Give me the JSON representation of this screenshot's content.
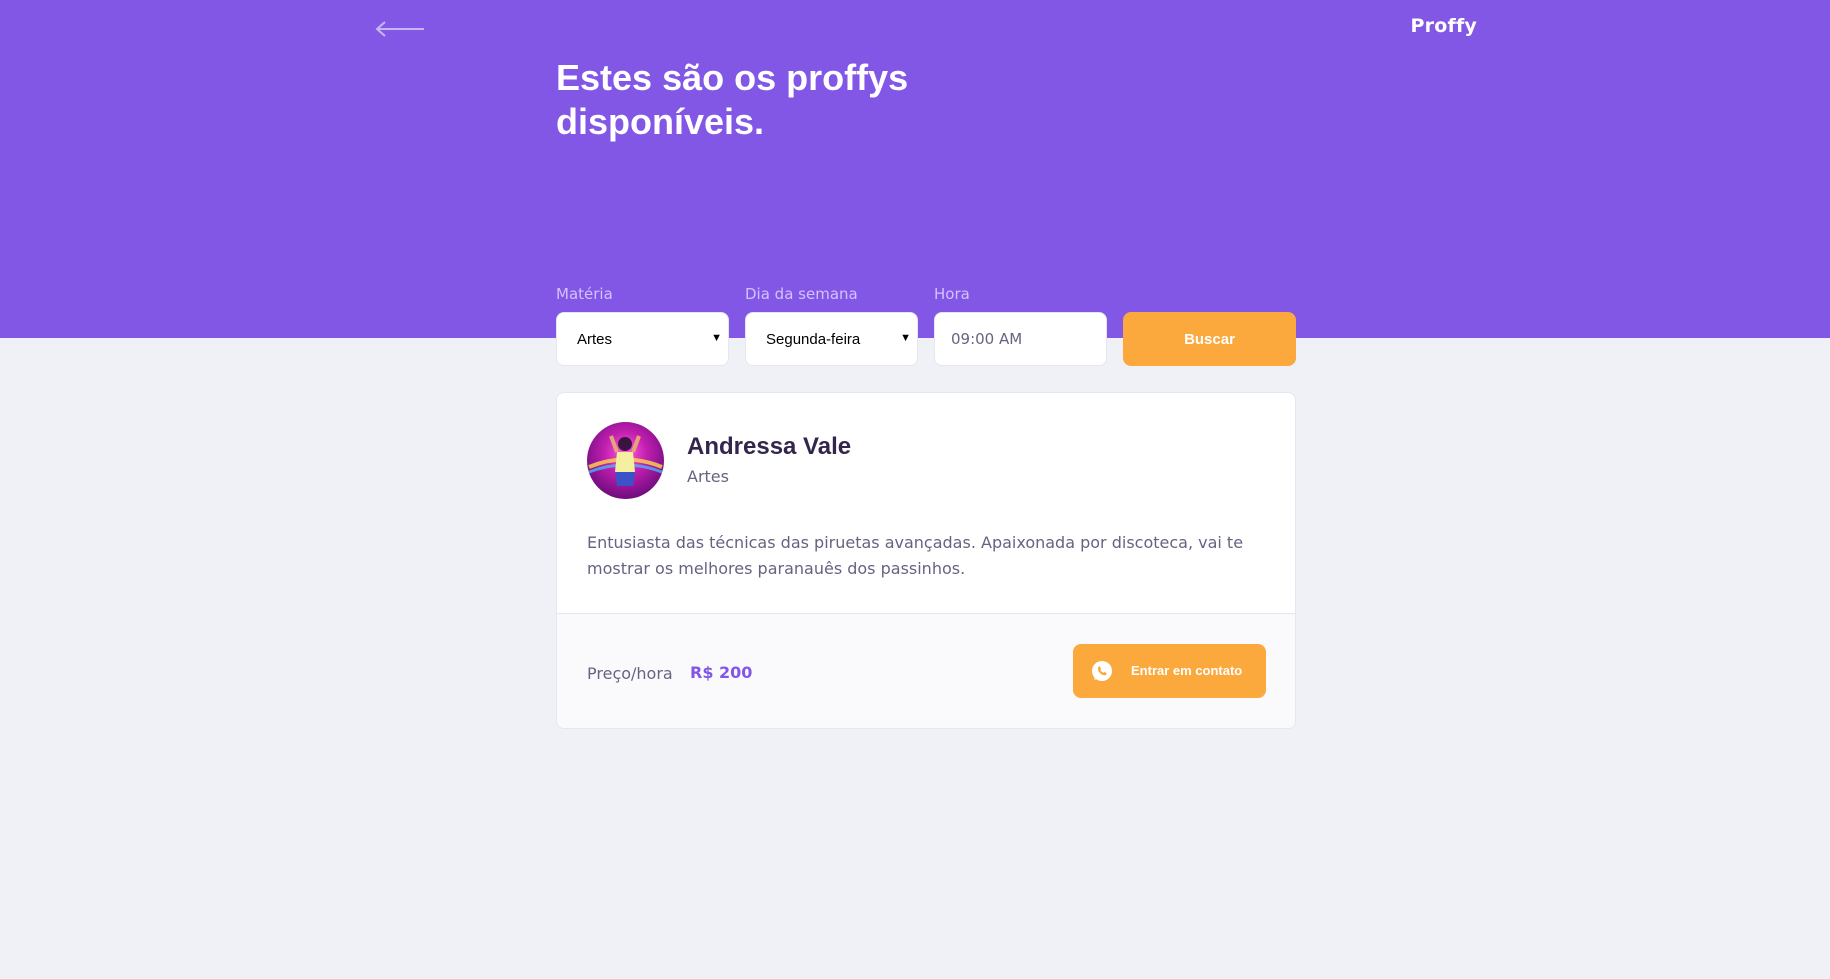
{
  "header": {
    "back_icon": "arrow-left-icon",
    "logo": "Proffy",
    "title": "Estes são os proffys disponíveis."
  },
  "filters": {
    "subject": {
      "label": "Matéria",
      "value": "Artes"
    },
    "weekday": {
      "label": "Dia da semana",
      "value": "Segunda-feira"
    },
    "time": {
      "label": "Hora",
      "value": "09:00 AM"
    },
    "search_label": "Buscar"
  },
  "teachers": [
    {
      "name": "Andressa Vale",
      "subject": "Artes",
      "bio": "Entusiasta das técnicas das piruetas avançadas. Apaixonada por discoteca, vai te mostrar os melhores paranauês dos passinhos.",
      "price_label": "Preço/hora",
      "price": "R$ 200",
      "contact_label": "Entrar em contato",
      "contact_icon": "whatsapp-icon"
    }
  ],
  "colors": {
    "primary": "#8257E5",
    "accent": "#FBA83D",
    "background": "#F0F0F7",
    "title_text": "#32264D",
    "body_text": "#6A6180"
  }
}
